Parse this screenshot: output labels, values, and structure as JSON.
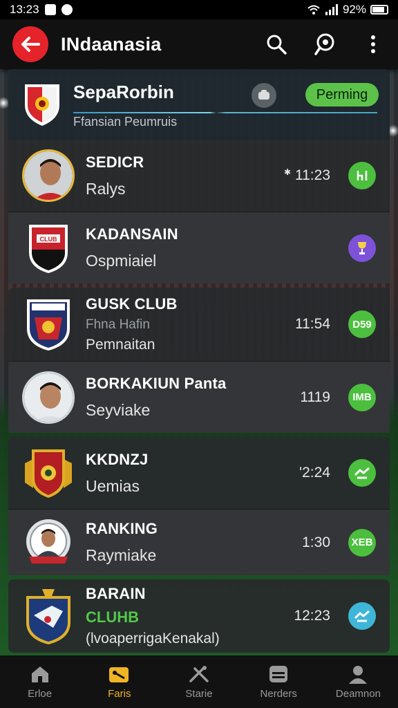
{
  "status_bar": {
    "time": "13:23",
    "battery": "92%"
  },
  "app_bar": {
    "title": "INdaanasia"
  },
  "header_card": {
    "title": "SepaRorbin",
    "subtitle": "Ffansian   Peumruis",
    "pill": "Perming"
  },
  "rows": [
    {
      "name": "SEDICR",
      "sub": "Ralys",
      "time": "11:23",
      "badge": "",
      "badge_color": "#4cbf3f"
    },
    {
      "name": "KADANSAIN",
      "sub": "Ospmiaiel",
      "time": "",
      "badge": "",
      "badge_color": "#7d52d8"
    },
    {
      "name": "GUSK CLUB",
      "sub_small": "Fhna Hafin",
      "sub": "Pemnaitan",
      "time": "11:54",
      "badge": "D59",
      "badge_color": "#4cbf3f"
    },
    {
      "name": "BORKAKIUN Panta",
      "sub": "Seyviake",
      "time": "1119",
      "badge": "IMB",
      "badge_color": "#4cbf3f"
    },
    {
      "name": "KKDNZJ",
      "sub": "Uemias",
      "time": "'2:24",
      "badge": "",
      "badge_color": "#4cbf3f"
    },
    {
      "name": "RANKING",
      "sub": "Raymiake",
      "time": "1:30",
      "badge": "XEB",
      "badge_color": "#4cbf3f"
    },
    {
      "name": "BARAIN",
      "sub_green": "CLUHB",
      "sub": "(lvoaperrigaKenakal)",
      "time": "12:23",
      "badge": "",
      "badge_color": "#3fb6d8"
    }
  ],
  "bottom_nav": [
    {
      "label": "Erloe",
      "icon": "home-icon"
    },
    {
      "label": "Faris",
      "icon": "tag-icon"
    },
    {
      "label": "Starie",
      "icon": "tools-icon"
    },
    {
      "label": "Nerders",
      "icon": "box-icon"
    },
    {
      "label": "Deamnon",
      "icon": "person-icon"
    }
  ],
  "colors": {
    "accent_red": "#e5232b",
    "green": "#5cc24a",
    "active_nav": "#f0b425"
  }
}
